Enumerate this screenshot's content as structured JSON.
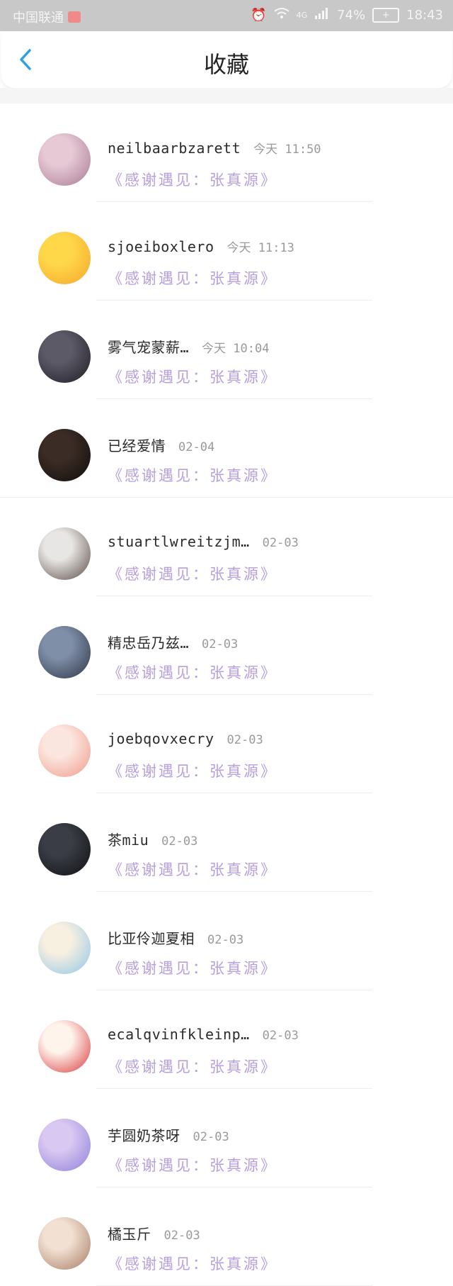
{
  "status_bar": {
    "carrier": "中国联通",
    "network": "4G",
    "battery": "74%",
    "time": "18:43"
  },
  "header": {
    "title": "收藏",
    "back_icon": "chevron-left-icon"
  },
  "items": [
    {
      "name": "neilbaarbzarett",
      "time": "今天 11:50",
      "quote": "《感谢遇见：张真源》",
      "avatar_colors": [
        "#e7c9d5",
        "#a87a95"
      ]
    },
    {
      "name": "sjoeiboxlero",
      "time": "今天 11:13",
      "quote": "《感谢遇见：张真源》",
      "avatar_colors": [
        "#ffd84a",
        "#f4a62a"
      ]
    },
    {
      "name": "雾气宠蒙薪…",
      "time": "今天 10:04",
      "quote": "《感谢遇见：张真源》",
      "avatar_colors": [
        "#5d5a68",
        "#1f1d24"
      ]
    },
    {
      "name": "已经爱情",
      "time": "02-04",
      "quote": "《感谢遇见：张真源》",
      "avatar_colors": [
        "#3b2c25",
        "#100c0a"
      ]
    },
    {
      "name": "stuartlwreitzjm…",
      "time": "02-03",
      "quote": "《感谢遇见：张真源》",
      "avatar_colors": [
        "#e8e6e4",
        "#5a4a44"
      ]
    },
    {
      "name": "精忠岳乃兹…",
      "time": "02-03",
      "quote": "《感谢遇见：张真源》",
      "avatar_colors": [
        "#7f8fa8",
        "#2e3546"
      ]
    },
    {
      "name": "joebqovxecry",
      "time": "02-03",
      "quote": "《感谢遇见：张真源》",
      "avatar_colors": [
        "#fbe6df",
        "#f09a8a"
      ]
    },
    {
      "name": "茶miu",
      "time": "02-03",
      "quote": "《感谢遇见：张真源》",
      "avatar_colors": [
        "#3a3d45",
        "#0f1014"
      ]
    },
    {
      "name": "比亚伶迦夏相",
      "time": "02-03",
      "quote": "《感谢遇见：张真源》",
      "avatar_colors": [
        "#f7efe0",
        "#8fc6e8"
      ]
    },
    {
      "name": "ecalqvinfkleinp…",
      "time": "02-03",
      "quote": "《感谢遇见：张真源》",
      "avatar_colors": [
        "#fff4ec",
        "#d9383a"
      ]
    },
    {
      "name": "芋圆奶茶呀",
      "time": "02-03",
      "quote": "《感谢遇见：张真源》",
      "avatar_colors": [
        "#d9c8f2",
        "#8f7fd8"
      ]
    },
    {
      "name": "橘玉斤",
      "time": "02-03",
      "quote": "《感谢遇见：张真源》",
      "avatar_colors": [
        "#f2e0d2",
        "#a67b62"
      ]
    }
  ]
}
